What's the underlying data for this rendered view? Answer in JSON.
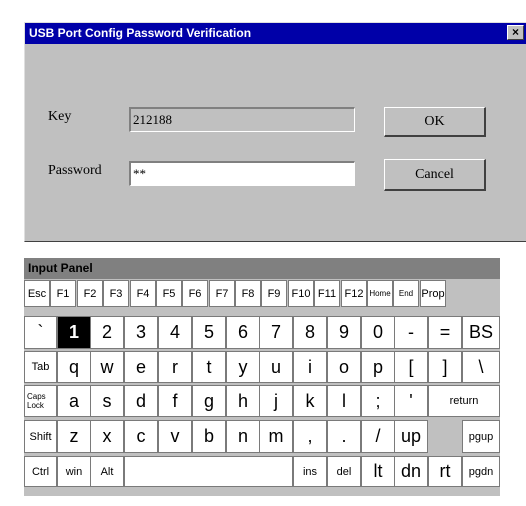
{
  "dialog": {
    "title": "USB Port Config Password Verification",
    "close_glyph": "×",
    "key_label": "Key",
    "key_value": "212188",
    "password_label": "Password",
    "password_value": "**",
    "ok_label": "OK",
    "cancel_label": "Cancel"
  },
  "input_panel": {
    "title": "Input Panel",
    "rows": [
      [
        "Esc",
        "F1",
        "F2",
        "F3",
        "F4",
        "F5",
        "F6",
        "F7",
        "F8",
        "F9",
        "F10",
        "F11",
        "F12",
        "Home",
        "End",
        "Prop"
      ],
      [
        "`",
        "1",
        "2",
        "3",
        "4",
        "5",
        "6",
        "7",
        "8",
        "9",
        "0",
        "-",
        "=",
        "BS"
      ],
      [
        "Tab",
        "q",
        "w",
        "e",
        "r",
        "t",
        "y",
        "u",
        "i",
        "o",
        "p",
        "[",
        "]",
        "\\"
      ],
      [
        "Caps",
        "Lock",
        "a",
        "s",
        "d",
        "f",
        "g",
        "h",
        "j",
        "k",
        "l",
        ";",
        "'",
        "return"
      ],
      [
        "Shift",
        "z",
        "x",
        "c",
        "v",
        "b",
        "n",
        "m",
        ",",
        ".",
        "/",
        "up",
        "pgup"
      ],
      [
        "Ctrl",
        "win",
        "Alt",
        "ins",
        "del",
        "lt",
        "dn",
        "rt",
        "pgdn"
      ]
    ],
    "highlighted_key": "1"
  }
}
